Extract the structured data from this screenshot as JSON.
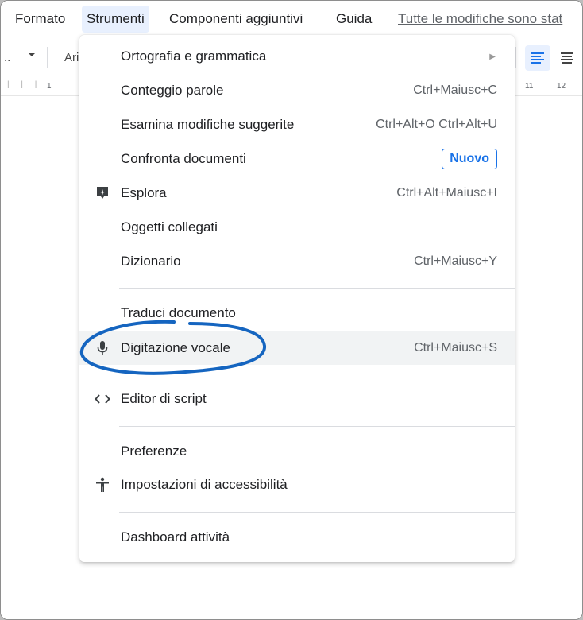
{
  "menubar": {
    "items": [
      {
        "label": "Formato"
      },
      {
        "label": "Strumenti"
      },
      {
        "label": "Componenti aggiuntivi"
      },
      {
        "label": "Guida"
      }
    ],
    "status": "Tutte le modifiche sono stat"
  },
  "toolbar": {
    "zoom_fragment": "..",
    "font_fragment": "Ari"
  },
  "ruler": {
    "left_mark": "1",
    "right_marks": [
      "11",
      "12"
    ]
  },
  "tools_menu": {
    "items": [
      {
        "label": "Ortografia e grammatica",
        "shortcut": "",
        "submenu": true
      },
      {
        "label": "Conteggio parole",
        "shortcut": "Ctrl+Maiusc+C"
      },
      {
        "label": "Esamina modifiche suggerite",
        "shortcut": "Ctrl+Alt+O Ctrl+Alt+U"
      },
      {
        "label": "Confronta documenti",
        "badge": "Nuovo"
      },
      {
        "label": "Esplora",
        "shortcut": "Ctrl+Alt+Maiusc+I",
        "icon": "explore-icon"
      },
      {
        "label": "Oggetti collegati",
        "shortcut": ""
      },
      {
        "label": "Dizionario",
        "shortcut": "Ctrl+Maiusc+Y"
      },
      {
        "label": "Traduci documento",
        "shortcut": ""
      },
      {
        "label": "Digitazione vocale",
        "shortcut": "Ctrl+Maiusc+S",
        "icon": "microphone-icon",
        "highlighted": true
      },
      {
        "label": "Editor di script",
        "shortcut": "",
        "icon": "code-icon"
      },
      {
        "label": "Preferenze",
        "shortcut": ""
      },
      {
        "label": "Impostazioni di accessibilità",
        "shortcut": "",
        "icon": "accessibility-icon"
      },
      {
        "label": "Dashboard attività",
        "shortcut": ""
      }
    ]
  },
  "colors": {
    "accent": "#1a73e8",
    "annotation": "#1565c0",
    "hover": "#f1f3f4",
    "active_menu": "#e8f0fe"
  }
}
